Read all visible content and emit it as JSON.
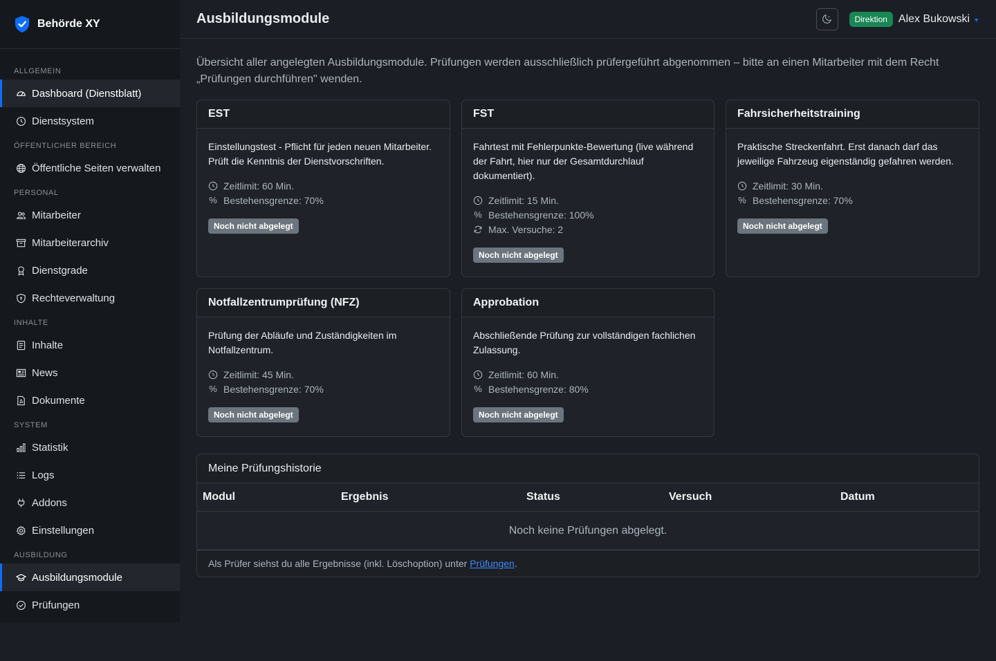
{
  "brand": {
    "name": "Behörde XY",
    "accent": "#0d6efd"
  },
  "sidebar": {
    "sections": [
      {
        "title": "ALLGEMEIN",
        "items": [
          {
            "label": "Dashboard (Dienstblatt)",
            "icon": "dashboard-icon",
            "active": true
          },
          {
            "label": "Dienstsystem",
            "icon": "clock-icon"
          }
        ]
      },
      {
        "title": "ÖFFENTLICHER BEREICH",
        "items": [
          {
            "label": "Öffentliche Seiten verwalten",
            "icon": "globe-icon"
          }
        ]
      },
      {
        "title": "PERSONAL",
        "items": [
          {
            "label": "Mitarbeiter",
            "icon": "people-icon"
          },
          {
            "label": "Mitarbeiterarchiv",
            "icon": "archive-icon"
          },
          {
            "label": "Dienstgrade",
            "icon": "award-icon"
          },
          {
            "label": "Rechteverwaltung",
            "icon": "shield-lock-icon"
          }
        ]
      },
      {
        "title": "INHALTE",
        "items": [
          {
            "label": "Inhalte",
            "icon": "file-text-icon"
          },
          {
            "label": "News",
            "icon": "newspaper-icon"
          },
          {
            "label": "Dokumente",
            "icon": "file-pdf-icon"
          }
        ]
      },
      {
        "title": "SYSTEM",
        "items": [
          {
            "label": "Statistik",
            "icon": "bar-chart-icon"
          },
          {
            "label": "Logs",
            "icon": "list-icon"
          },
          {
            "label": "Addons",
            "icon": "plug-icon"
          },
          {
            "label": "Einstellungen",
            "icon": "gear-icon"
          }
        ]
      },
      {
        "title": "AUSBILDUNG",
        "items": [
          {
            "label": "Ausbildungsmodule",
            "icon": "mortarboard-icon",
            "active": true
          },
          {
            "label": "Prüfungen",
            "icon": "check-circle-icon"
          }
        ]
      }
    ]
  },
  "topbar": {
    "title": "Ausbildungsmodule",
    "theme_toggle_icon": "moon-icon",
    "role_badge": "Direktion",
    "role_color": "#198754",
    "user_name": "Alex Bukowski"
  },
  "main": {
    "intro": "Übersicht aller angelegten Ausbildungsmodule. Prüfungen werden ausschließlich prüfergeführt abgenommen – bitte an einen Mitarbeiter mit dem Recht „Prüfungen durchführen\" wenden.",
    "modules": [
      {
        "title": "EST",
        "description": "Einstellungstest - Pflicht für jeden neuen Mitarbeiter. Prüft die Kenntnis der Dienstvorschriften.",
        "time_limit": "Zeitlimit: 60 Min.",
        "pass_mark": "Bestehensgrenze: 70%",
        "status": "Noch nicht abgelegt"
      },
      {
        "title": "FST",
        "description": "Fahrtest mit Fehlerpunkte-Bewertung (live während der Fahrt, hier nur der Gesamtdurchlauf dokumentiert).",
        "time_limit": "Zeitlimit: 15 Min.",
        "pass_mark": "Bestehensgrenze: 100%",
        "max_attempts": "Max. Versuche: 2",
        "status": "Noch nicht abgelegt"
      },
      {
        "title": "Fahrsicherheitstraining",
        "description": "Praktische Streckenfahrt. Erst danach darf das jeweilige Fahrzeug eigenständig gefahren werden.",
        "time_limit": "Zeitlimit: 30 Min.",
        "pass_mark": "Bestehensgrenze: 70%",
        "status": "Noch nicht abgelegt"
      },
      {
        "title": "Notfallzentrumprüfung (NFZ)",
        "description": "Prüfung der Abläufe und Zuständigkeiten im Notfallzentrum.",
        "time_limit": "Zeitlimit: 45 Min.",
        "pass_mark": "Bestehensgrenze: 70%",
        "status": "Noch nicht abgelegt"
      },
      {
        "title": "Approbation",
        "description": "Abschließende Prüfung zur vollständigen fachlichen Zulassung.",
        "time_limit": "Zeitlimit: 60 Min.",
        "pass_mark": "Bestehensgrenze: 80%",
        "status": "Noch nicht abgelegt"
      }
    ]
  },
  "history": {
    "title": "Meine Prüfungshistorie",
    "columns": [
      "Modul",
      "Ergebnis",
      "Status",
      "Versuch",
      "Datum"
    ],
    "empty_text": "Noch keine Prüfungen abgelegt.",
    "footer_text": "Als Prüfer siehst du alle Ergebnisse (inkl. Löschoption) unter ",
    "footer_link": "Prüfungen",
    "footer_end": "."
  }
}
